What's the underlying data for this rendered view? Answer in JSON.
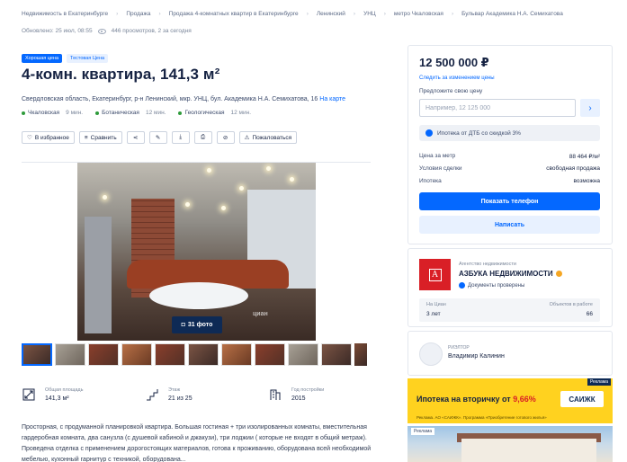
{
  "breadcrumbs": [
    "Недвижимость в Екатеринбурге",
    "Продажа",
    "Продажа 4-комнатных квартир в Екатеринбурге",
    "Ленинский",
    "УНЦ",
    "метро Чкаловская",
    "Бульвар Академика Н.А. Семихатова"
  ],
  "meta": {
    "updated": "Обновлено: 25 июл, 08:55",
    "views": "446 просмотров, 2 за сегодня"
  },
  "badges": {
    "owner": "Хорошая цена",
    "price_drop": "Тестовая Цена"
  },
  "title": "4-комн. квартира, 141,3 м²",
  "address": {
    "text": "Свердловская область, Екатеринбург, р-н Ленинский, мкр. УНЦ, бул. Академика Н.А. Семихатова, 16",
    "map_link": "На карте"
  },
  "metros": [
    {
      "name": "Чкаловская",
      "time": "9 мин."
    },
    {
      "name": "Ботаническая",
      "time": "12 мин."
    },
    {
      "name": "Геологическая",
      "time": "12 мин."
    }
  ],
  "actions": {
    "favorite": "В избранное",
    "compare": "Сравнить",
    "report": "Пожаловаться"
  },
  "photo": {
    "count": "31 фото",
    "watermark": "циан"
  },
  "facts": [
    {
      "label": "Общая площадь",
      "value": "141,3 м²",
      "icon": "area-icon"
    },
    {
      "label": "Этаж",
      "value": "21 из 25",
      "icon": "stairs-icon"
    },
    {
      "label": "Год постройки",
      "value": "2015",
      "icon": "building-icon"
    }
  ],
  "description": "Просторная, с продуманной планировкой квартира. Большая гостиная + три изолированных комнаты, вместительная гардеробная комната, два санузла (с душевой кабиной и джакузи), три лоджии ( которые не входят в общий метраж). Проведена отделка с применением дорогостоящих материалов, готова к проживанию, оборудована всей необходимой мебелью, кухонный гарнитур с техникой, оборудована...",
  "price_card": {
    "price": "12 500 000 ₽",
    "watch_price": "Следить за изменением цены",
    "offer_label": "Предложите свою цену",
    "offer_placeholder": "Например, 12 125 000",
    "offer_button": "›",
    "mortgage": "Ипотека от ДТБ со скидкой 3%",
    "rows": [
      {
        "key": "Цена за метр",
        "value": "88 464 ₽/м²"
      },
      {
        "key": "Условия сделки",
        "value": "свободная продажа"
      },
      {
        "key": "Ипотека",
        "value": "возможна"
      }
    ],
    "show_phone": "Показать телефон",
    "write": "Написать"
  },
  "agency": {
    "type": "Агентство недвижимости",
    "name": "АЗБУКА НЕДВИЖИМОСТИ",
    "verified": "Документы проверены",
    "stat_left_label": "На Циан",
    "stat_left_value": "3 лет",
    "stat_right_label": "Объектов в работе",
    "stat_right_value": "66"
  },
  "realtor": {
    "role": "РИЭЛТОР",
    "name": "Владимир Калинин"
  },
  "ad": {
    "tag": "Реклама",
    "text_prefix": "Ипотека на вторичку от ",
    "text_rate": "9,66%",
    "logo": "САИЖК",
    "footer": "Реклама. АО «САИЖК». Программа «Приобретение готового жилья»"
  },
  "ad2": {
    "label": "Реклама"
  },
  "colors": {
    "accent": "#0468ff",
    "text": "#152242",
    "ad_yellow": "#ffd21f",
    "agency_red": "#d91f26"
  }
}
